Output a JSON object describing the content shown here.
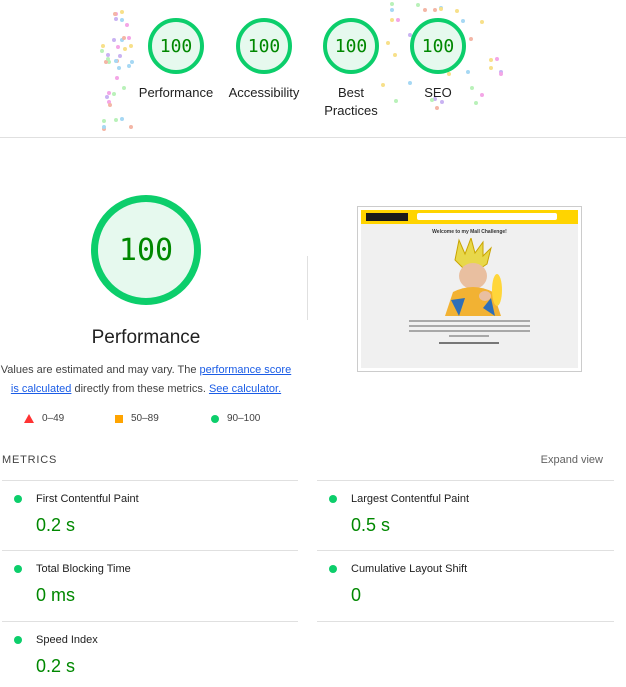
{
  "summary": {
    "gauges": [
      {
        "score": "100",
        "label": "Performance"
      },
      {
        "score": "100",
        "label": "Accessibility"
      },
      {
        "score": "100",
        "label": "Best Practices"
      },
      {
        "score": "100",
        "label": "SEO"
      }
    ]
  },
  "performance": {
    "score": "100",
    "title": "Performance",
    "disclaimer_prefix": "Values are estimated and may vary. The ",
    "score_link": "performance score is calculated",
    "disclaimer_suffix": " directly from these metrics. ",
    "calculator_link": "See calculator."
  },
  "legend": {
    "fail": "0–49",
    "average": "50–89",
    "pass": "90–100"
  },
  "preview": {
    "heading": "Welcome to my Mall Challenge!"
  },
  "metrics": {
    "title": "METRICS",
    "expand_label": "Expand view",
    "items": [
      {
        "label": "First Contentful Paint",
        "value": "0.2 s"
      },
      {
        "label": "Largest Contentful Paint",
        "value": "0.5 s"
      },
      {
        "label": "Total Blocking Time",
        "value": "0 ms"
      },
      {
        "label": "Cumulative Layout Shift",
        "value": "0"
      },
      {
        "label": "Speed Index",
        "value": "0.2 s"
      }
    ]
  },
  "colors": {
    "pass": "#0cce6b",
    "pass_text": "#008800",
    "average": "#ffa400",
    "fail": "#ff3333",
    "link": "#1a5ce6"
  }
}
